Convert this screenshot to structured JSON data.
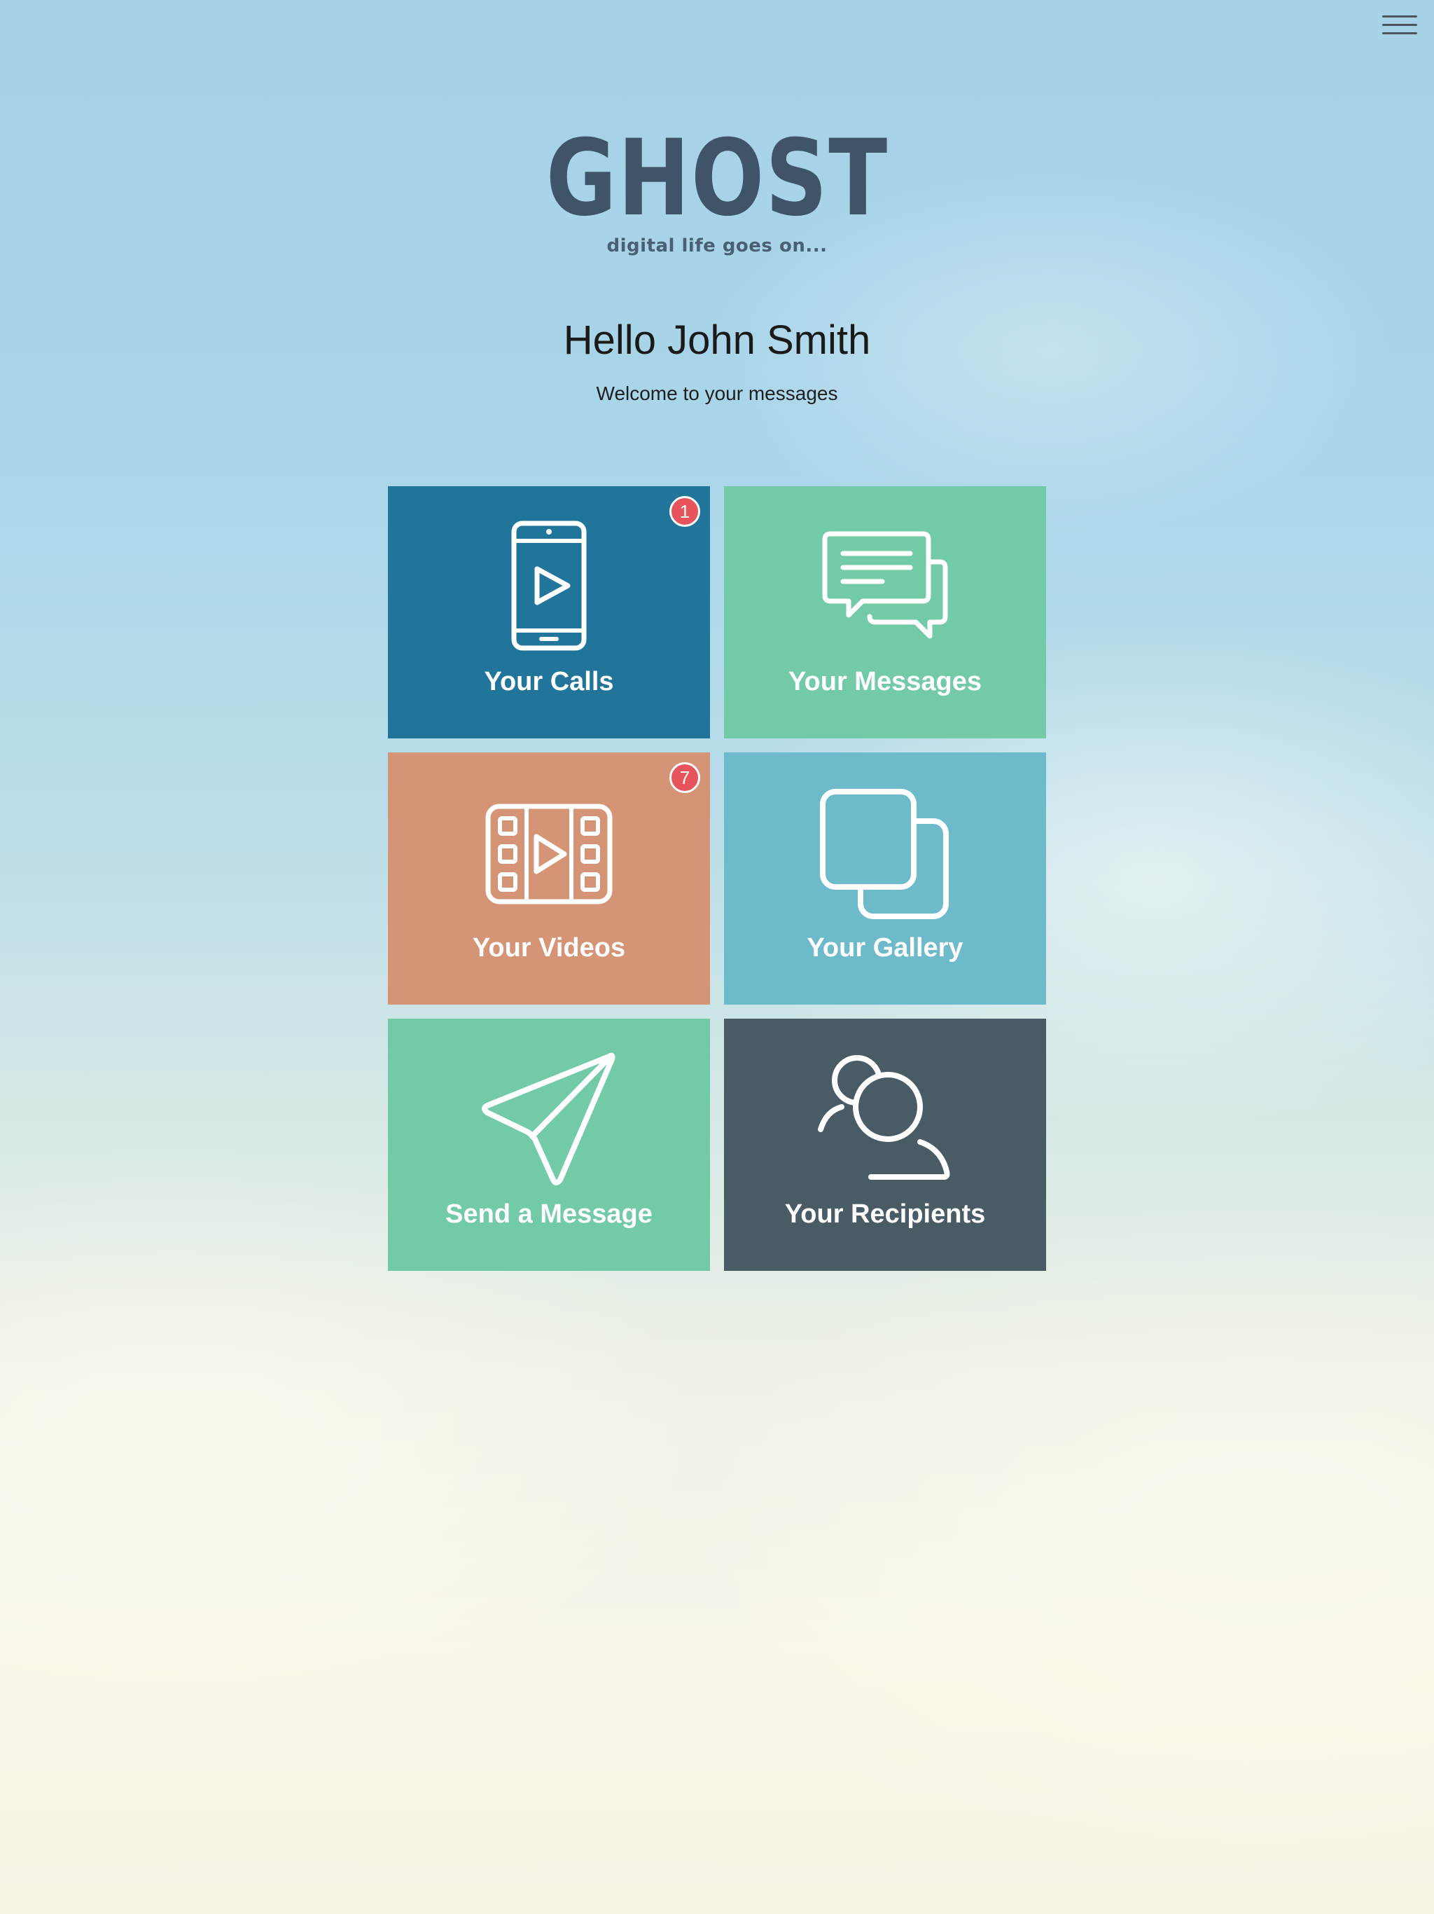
{
  "logo": {
    "wordmark": "GHOST",
    "tagline": "digital life goes on..."
  },
  "header": {
    "greeting": "Hello John Smith",
    "subtitle": "Welcome to your messages"
  },
  "menu": {
    "icon": "hamburger-menu-icon"
  },
  "tiles": [
    {
      "label": "Your Calls",
      "icon": "phone-video-icon",
      "color": "#21759b",
      "badge": "1"
    },
    {
      "label": "Your Messages",
      "icon": "chat-bubbles-icon",
      "color": "#72cba6",
      "badge": null
    },
    {
      "label": "Your Videos",
      "icon": "film-strip-icon",
      "color": "#d49475",
      "badge": "7"
    },
    {
      "label": "Your Gallery",
      "icon": "gallery-squares-icon",
      "color": "#6dbbca",
      "badge": null
    },
    {
      "label": "Send a Message",
      "icon": "paper-plane-icon",
      "color": "#72cba6",
      "badge": null
    },
    {
      "label": "Your Recipients",
      "icon": "people-icon",
      "color": "#495b65",
      "badge": null
    }
  ],
  "colors": {
    "badge": "#e8545b",
    "logo": "#3f5468"
  }
}
